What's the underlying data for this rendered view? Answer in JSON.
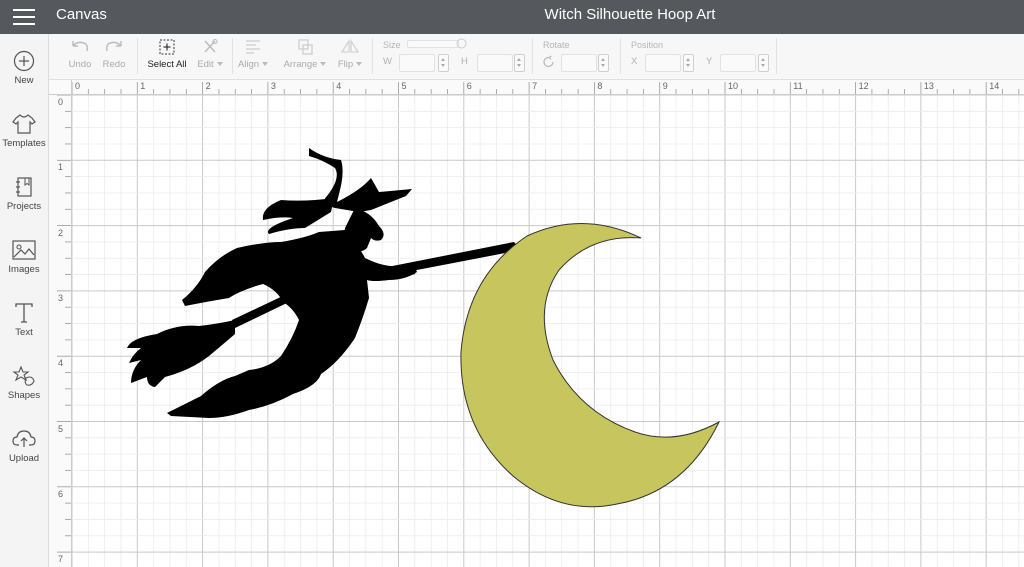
{
  "header": {
    "app_name": "Canvas",
    "project_title": "Witch Silhouette Hoop Art"
  },
  "sidebar": {
    "items": [
      {
        "label": "New",
        "icon": "plus-circle-icon"
      },
      {
        "label": "Templates",
        "icon": "tshirt-icon"
      },
      {
        "label": "Projects",
        "icon": "notebook-icon"
      },
      {
        "label": "Images",
        "icon": "image-icon"
      },
      {
        "label": "Text",
        "icon": "text-icon"
      },
      {
        "label": "Shapes",
        "icon": "shapes-icon"
      },
      {
        "label": "Upload",
        "icon": "cloud-upload-icon"
      }
    ]
  },
  "toolbar": {
    "undo_label": "Undo",
    "redo_label": "Redo",
    "select_all_label": "Select All",
    "edit_label": "Edit",
    "align_label": "Align",
    "arrange_label": "Arrange",
    "flip_label": "Flip",
    "size_heading": "Size",
    "size_w_label": "W",
    "size_h_label": "H",
    "rotate_heading": "Rotate",
    "position_heading": "Position",
    "position_x_label": "X",
    "position_y_label": "Y"
  },
  "rulers": {
    "horizontal": [
      "0",
      "1",
      "2",
      "3",
      "4",
      "5",
      "6",
      "7",
      "8",
      "9",
      "10",
      "11",
      "12",
      "13",
      "14"
    ],
    "vertical": [
      "0",
      "1",
      "2",
      "3",
      "4",
      "5",
      "6",
      "7"
    ]
  },
  "canvas": {
    "objects": [
      {
        "name": "witch-silhouette",
        "color": "#000000"
      },
      {
        "name": "crescent-moon",
        "color": "#c7c55e"
      }
    ]
  },
  "colors": {
    "topbar": "#55595d",
    "moon": "#c7c55e",
    "grid_minor": "#ececec",
    "grid_major": "#c9c9c9"
  }
}
